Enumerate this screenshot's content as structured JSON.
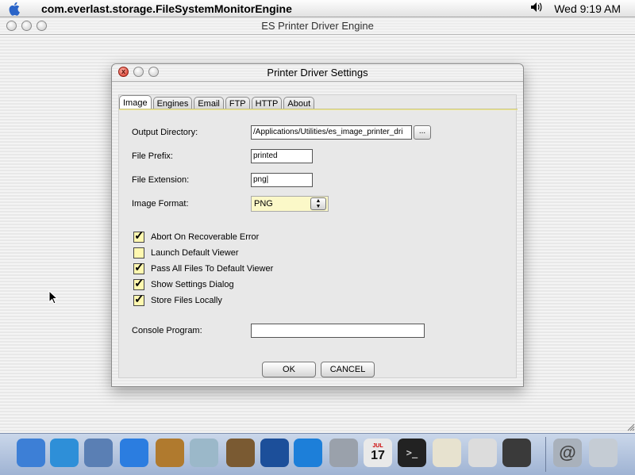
{
  "menubar": {
    "apple_icon": "apple-icon",
    "app_name": "com.everlast.storage.FileSystemMonitorEngine",
    "volume_icon": "speaker-icon",
    "clock": "Wed 9:19 AM"
  },
  "background_window": {
    "title": "ES Printer Driver Engine"
  },
  "dialog": {
    "title": "Printer Driver Settings",
    "tabs": [
      {
        "label": "Image",
        "active": true
      },
      {
        "label": "Engines"
      },
      {
        "label": "Email"
      },
      {
        "label": "FTP"
      },
      {
        "label": "HTTP"
      },
      {
        "label": "About"
      }
    ],
    "fields": {
      "output_directory_label": "Output Directory:",
      "output_directory_value": "/Applications/Utilities/es_image_printer_dri",
      "browse_label": "...",
      "file_prefix_label": "File Prefix:",
      "file_prefix_value": "printed",
      "file_extension_label": "File Extension:",
      "file_extension_value": "png|",
      "image_format_label": "Image Format:",
      "image_format_value": "PNG",
      "console_program_label": "Console Program:",
      "console_program_value": ""
    },
    "checkboxes": [
      {
        "label": "Abort On Recoverable Error",
        "checked": true
      },
      {
        "label": "Launch Default Viewer",
        "checked": false
      },
      {
        "label": "Pass All Files To Default Viewer",
        "checked": true
      },
      {
        "label": "Show Settings Dialog",
        "checked": true
      },
      {
        "label": "Store Files Locally",
        "checked": true
      }
    ],
    "ok_label": "OK",
    "cancel_label": "CANCEL"
  },
  "dock": {
    "items": [
      {
        "name": "finder-icon",
        "color": "#3d7fd6"
      },
      {
        "name": "safari-icon",
        "color": "#2e8fd8"
      },
      {
        "name": "mail-stamp-icon",
        "color": "#5a7fb4"
      },
      {
        "name": "ichat-icon",
        "color": "#2b7de0"
      },
      {
        "name": "address-book-icon",
        "color": "#b07a2e"
      },
      {
        "name": "itunes-icon",
        "color": "#9bb8c9"
      },
      {
        "name": "iphoto-icon",
        "color": "#7a5a32"
      },
      {
        "name": "imovie-icon",
        "color": "#1c4f9a"
      },
      {
        "name": "quicktime-icon",
        "color": "#1d7fd9"
      },
      {
        "name": "system-preferences-icon",
        "color": "#9aa1ab"
      },
      {
        "name": "ical-icon",
        "color": "#e9e9e9"
      },
      {
        "name": "terminal-icon",
        "color": "#222222"
      },
      {
        "name": "textedit-icon",
        "color": "#e7e2cf"
      },
      {
        "name": "printer-icon",
        "color": "#dcdcdc"
      },
      {
        "name": "console-icon",
        "color": "#3a3a3a"
      },
      {
        "name": "network-icon",
        "color": "#a9b1bb"
      },
      {
        "name": "trash-icon",
        "color": "#c5ccd4"
      }
    ],
    "ical_date": "17",
    "ical_month": "JUL"
  }
}
